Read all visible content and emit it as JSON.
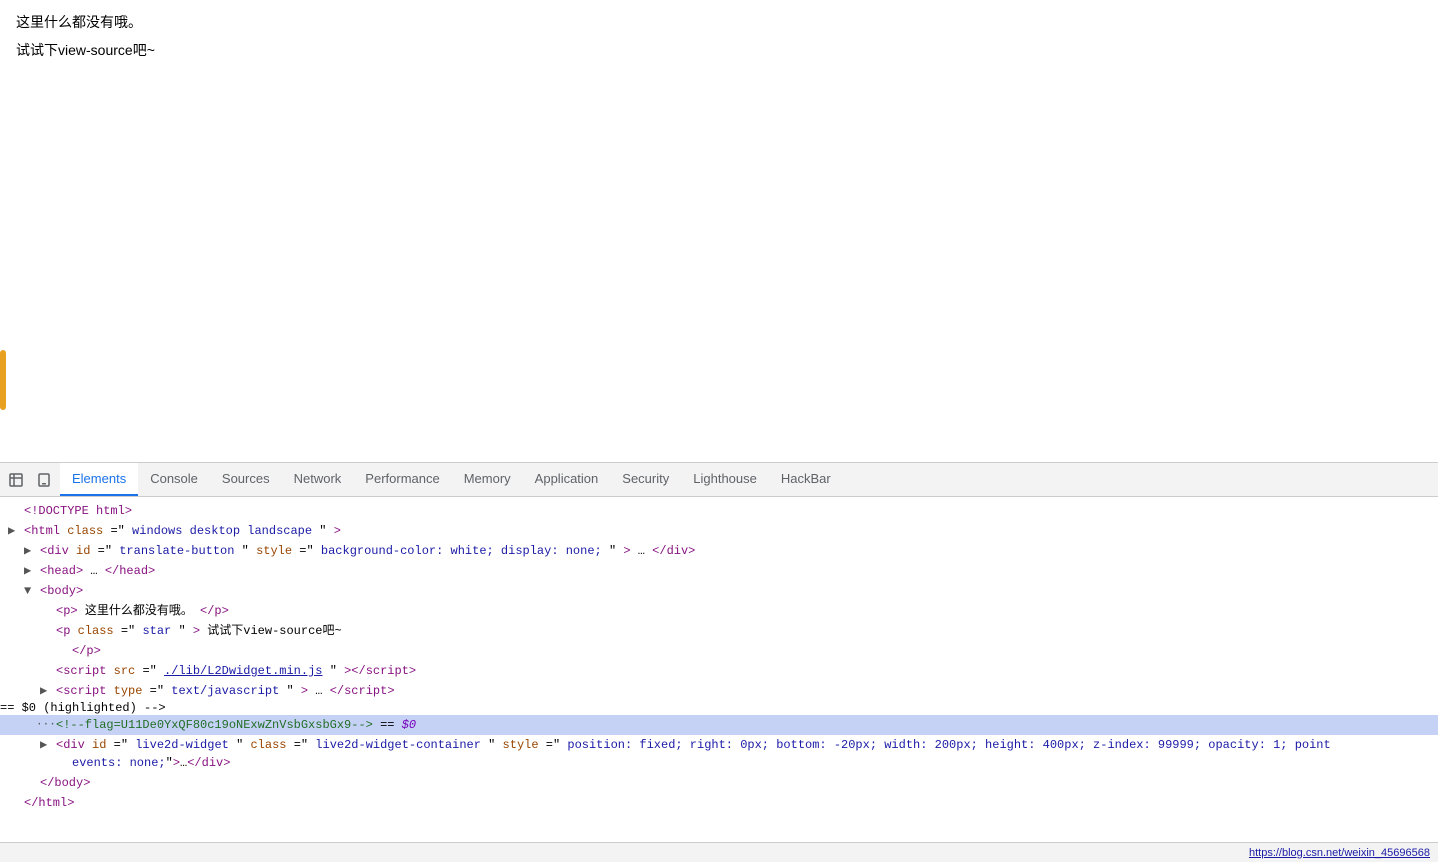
{
  "page": {
    "line1": "这里什么都没有哦。",
    "line2": "试试下view-source吧~"
  },
  "devtools": {
    "tabs": [
      {
        "id": "elements",
        "label": "Elements",
        "active": true
      },
      {
        "id": "console",
        "label": "Console",
        "active": false
      },
      {
        "id": "sources",
        "label": "Sources",
        "active": false
      },
      {
        "id": "network",
        "label": "Network",
        "active": false
      },
      {
        "id": "performance",
        "label": "Performance",
        "active": false
      },
      {
        "id": "memory",
        "label": "Memory",
        "active": false
      },
      {
        "id": "application",
        "label": "Application",
        "active": false
      },
      {
        "id": "security",
        "label": "Security",
        "active": false
      },
      {
        "id": "lighthouse",
        "label": "Lighthouse",
        "active": false
      },
      {
        "id": "hackbar",
        "label": "HackBar",
        "active": false
      }
    ],
    "code_lines": [
      {
        "id": "doctype",
        "indent": 0,
        "content": "DOCTYPE",
        "type": "doctype",
        "arrow": null,
        "dots": null
      },
      {
        "id": "html-open",
        "indent": 0,
        "content": "html-open",
        "type": "html",
        "arrow": "▶",
        "dots": null
      },
      {
        "id": "div-translate",
        "indent": 1,
        "content": "div-translate",
        "type": "div",
        "arrow": "▶",
        "dots": null
      },
      {
        "id": "head",
        "indent": 1,
        "content": "head",
        "type": "head",
        "arrow": "▶",
        "dots": null
      },
      {
        "id": "body-open",
        "indent": 1,
        "content": "body-open",
        "type": "body",
        "arrow": "▼",
        "dots": null
      },
      {
        "id": "p1",
        "indent": 2,
        "content": "p1",
        "type": "p",
        "arrow": null,
        "dots": null
      },
      {
        "id": "p2-open",
        "indent": 2,
        "content": "p2-open",
        "type": "p-star",
        "arrow": null,
        "dots": null
      },
      {
        "id": "p2-close",
        "indent": 3,
        "content": "p2-close",
        "type": "p-close",
        "arrow": null,
        "dots": null
      },
      {
        "id": "script1",
        "indent": 2,
        "content": "script1",
        "type": "script1",
        "arrow": null,
        "dots": null
      },
      {
        "id": "script2",
        "indent": 2,
        "content": "script2",
        "type": "script2",
        "arrow": "▶",
        "dots": null
      },
      {
        "id": "comment-flag",
        "indent": 2,
        "content": "comment-flag",
        "type": "flag",
        "arrow": null,
        "dots": "···"
      },
      {
        "id": "div-live2d",
        "indent": 2,
        "content": "div-live2d",
        "type": "live2d",
        "arrow": "▶",
        "dots": null
      },
      {
        "id": "body-close",
        "indent": 1,
        "content": "body-close",
        "type": "body-close",
        "arrow": null,
        "dots": null
      },
      {
        "id": "html-close",
        "indent": 0,
        "content": "html-close",
        "type": "html-close",
        "arrow": null,
        "dots": null
      }
    ],
    "status_url": "https://blog.csn.net/weixin_45696568"
  }
}
